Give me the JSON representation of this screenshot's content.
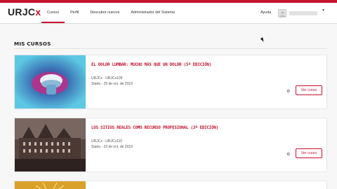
{
  "header": {
    "logo_text": "URJC",
    "logo_x": "x",
    "nav": [
      "Cursos",
      "Perfil",
      "Descubrir nuevos",
      "Administrador del Sistema"
    ],
    "active_nav_index": 0,
    "help_label": "Ayuda",
    "user_menu_icon": "chevron-down-icon"
  },
  "page": {
    "section_title": "MIS CURSOS"
  },
  "courses": [
    {
      "title": "EL DOLOR LUMBAR: MUCHO MÁS QUE UN DOLOR (5ª EDICIÓN)",
      "org_code": "URJCx - URJCx109",
      "starts": "Starts - 29 de oct. de 2019",
      "button": "Ver curso",
      "settings_icon": "gear-icon"
    },
    {
      "title": "LOS SITIOS REALES COMO RECURSO PROFESIONAL (3ª EDICIÓN)",
      "org_code": "URJCx - URJCx110",
      "starts": "Starts - 23 de oct. de 2019",
      "button": "Ver curso",
      "settings_icon": "gear-icon"
    }
  ],
  "colors": {
    "brand": "#c4122f",
    "background": "#f7f7f7"
  }
}
